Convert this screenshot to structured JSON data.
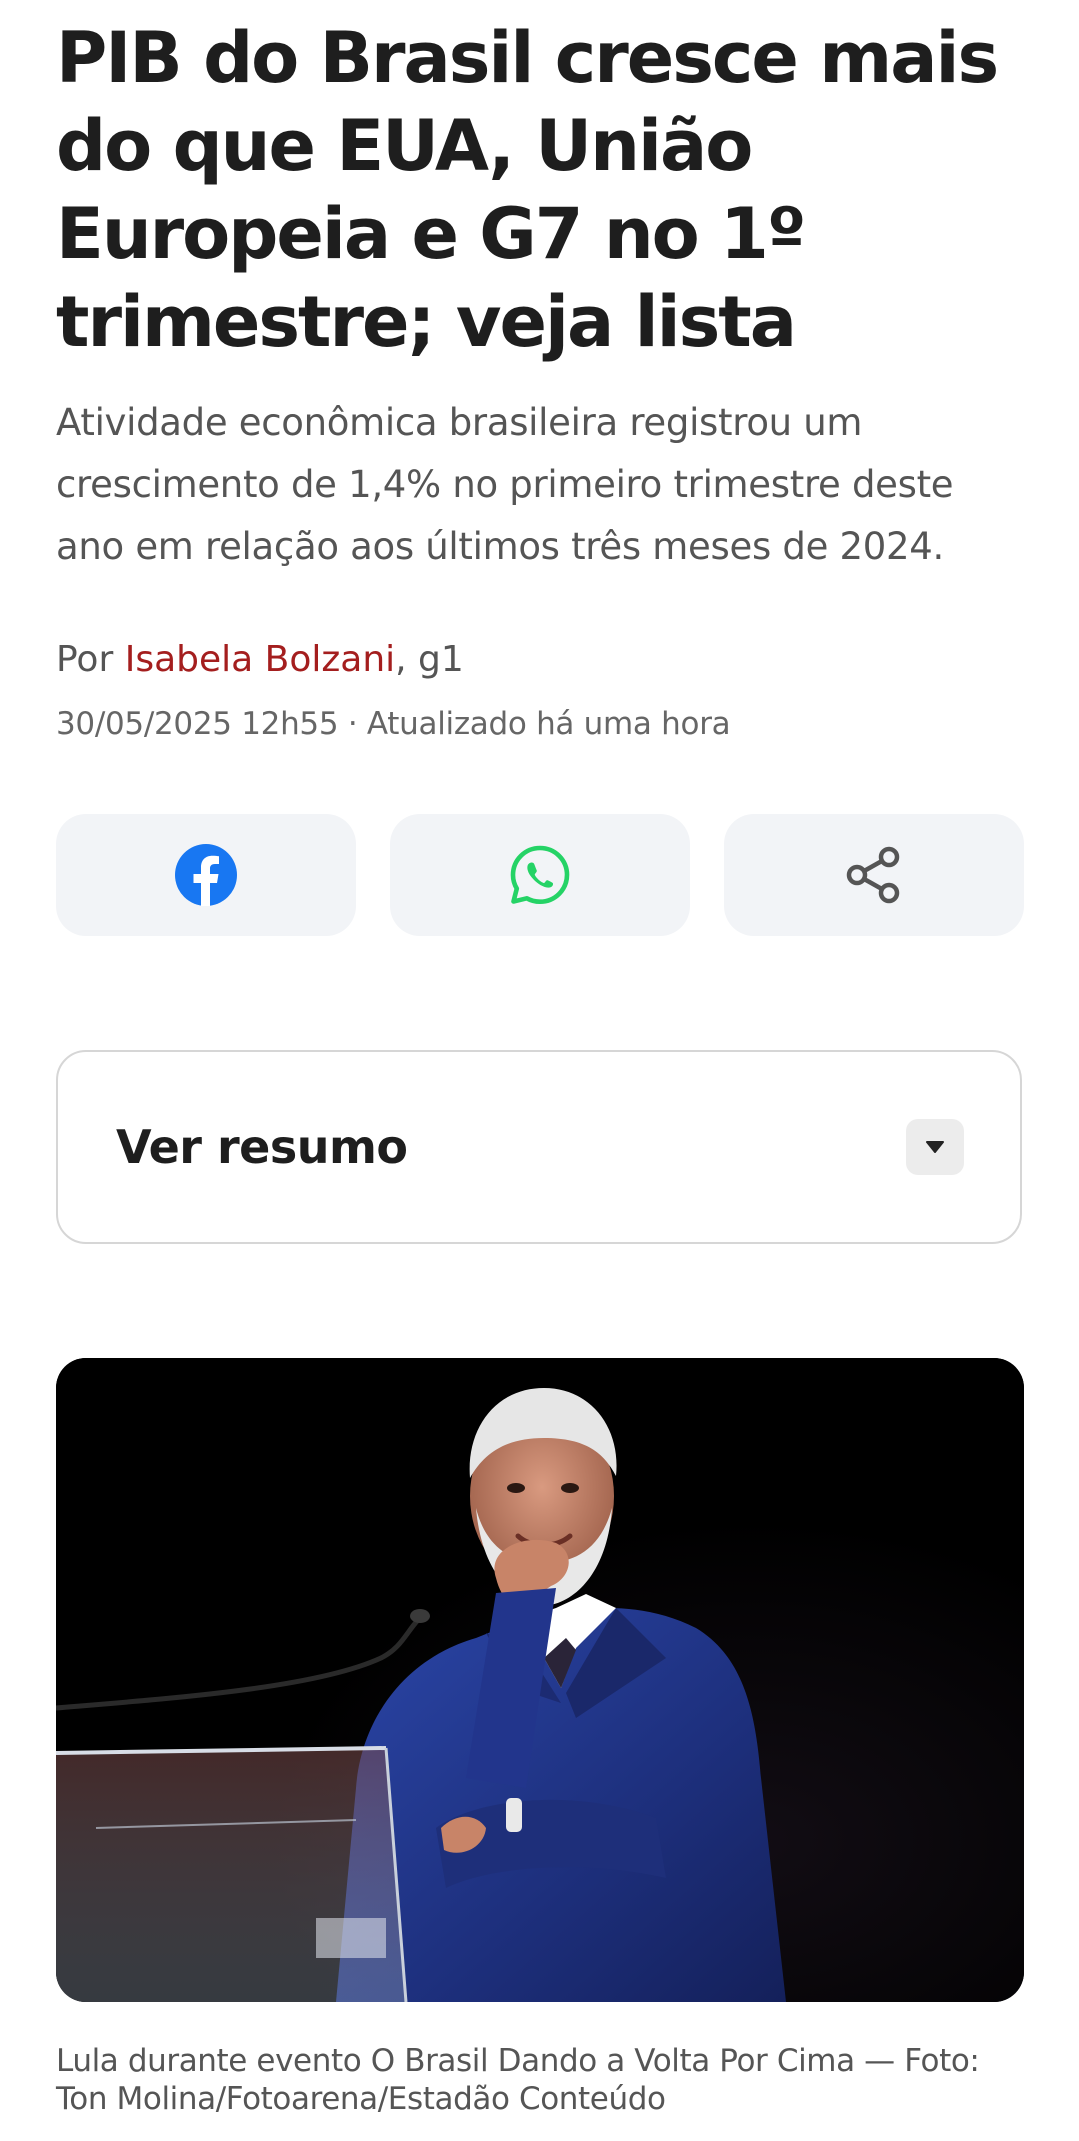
{
  "article": {
    "headline": "PIB do Brasil cresce mais do que EUA, União Europeia e G7 no 1º trimestre; veja lista",
    "subtitle": "Atividade econômica brasileira registrou um crescimento de 1,4% no primeiro trimestre deste ano em relação aos últimos três meses de 2024.",
    "byline_prefix": "Por ",
    "author": "Isabela Bolzani",
    "byline_suffix": ", g1",
    "dateline": "30/05/2025 12h55 · Atualizado há uma hora"
  },
  "share": {
    "buttons": [
      {
        "icon": "facebook-icon",
        "color": "#1877f2"
      },
      {
        "icon": "whatsapp-icon",
        "color": "#25d366"
      },
      {
        "icon": "share-icon",
        "color": "#555555"
      }
    ]
  },
  "summary": {
    "label": "Ver resumo",
    "icon": "caret-down-icon"
  },
  "photo": {
    "caption": "Lula durante evento O Brasil Dando a Volta Por Cima — Foto: Ton Molina/Fotoarena/Estadão Conteúdo"
  },
  "colors": {
    "author_link": "#a41e1e",
    "button_background": "#f2f4f7"
  }
}
